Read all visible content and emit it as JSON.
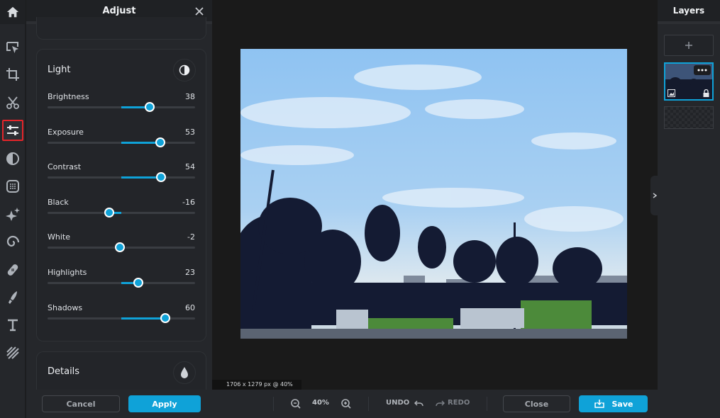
{
  "left_rail": {
    "items": [
      {
        "name": "home",
        "active": false
      },
      {
        "name": "select",
        "active": false
      },
      {
        "name": "crop",
        "active": false
      },
      {
        "name": "cutout",
        "active": false
      },
      {
        "name": "adjust",
        "active": true
      },
      {
        "name": "filters",
        "active": false
      },
      {
        "name": "effects",
        "active": false
      },
      {
        "name": "magic",
        "active": false
      },
      {
        "name": "distort",
        "active": false
      },
      {
        "name": "retouch",
        "active": false
      },
      {
        "name": "paint",
        "active": false
      },
      {
        "name": "text",
        "active": false
      },
      {
        "name": "textures",
        "active": false
      }
    ]
  },
  "panel": {
    "title": "Adjust",
    "sections": {
      "light": {
        "title": "Light",
        "icon": "half-circle-contrast-icon",
        "sliders": [
          {
            "label": "Brightness",
            "value": "38",
            "num": 38
          },
          {
            "label": "Exposure",
            "value": "53",
            "num": 53
          },
          {
            "label": "Contrast",
            "value": "54",
            "num": 54
          },
          {
            "label": "Black",
            "value": "-16",
            "num": -16
          },
          {
            "label": "White",
            "value": "-2",
            "num": -2
          },
          {
            "label": "Highlights",
            "value": "23",
            "num": 23
          },
          {
            "label": "Shadows",
            "value": "60",
            "num": 60
          }
        ],
        "range": [
          -100,
          100
        ]
      },
      "details": {
        "title": "Details",
        "icon": "droplet-icon"
      }
    },
    "cancel_label": "Cancel",
    "apply_label": "Apply"
  },
  "canvas": {
    "info": "1706 x 1279 px @ 40%"
  },
  "toolbar": {
    "zoom_level": "40%",
    "undo_label": "UNDO",
    "redo_label": "REDO",
    "close_label": "Close",
    "save_label": "Save"
  },
  "layers": {
    "title": "Layers",
    "add_label": "+"
  },
  "colors": {
    "accent": "#0fa2d8",
    "active_outline": "#e5252a",
    "panel_bg": "#25272b",
    "canvas_bg": "#1a1a1a"
  }
}
